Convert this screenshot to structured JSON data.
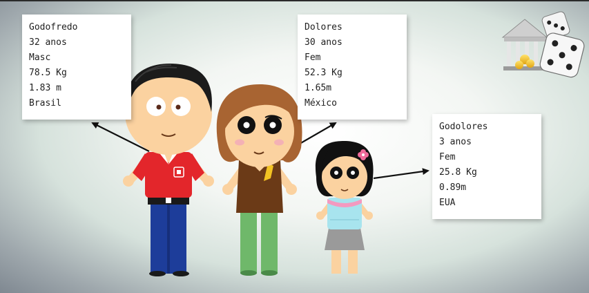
{
  "people": [
    {
      "id": "godofredo",
      "name": "Godofredo",
      "age": "32 anos",
      "sex": "Masc",
      "weight": "78.5 Kg",
      "height": "1.83 m",
      "country": "Brasil"
    },
    {
      "id": "dolores",
      "name": "Dolores",
      "age": "30 anos",
      "sex": "Fem",
      "weight": "52.3 Kg",
      "height": "1.65m",
      "country": "México"
    },
    {
      "id": "godolores",
      "name": "Godolores",
      "age": "3 anos",
      "sex": "Fem",
      "weight": "25.8 Kg",
      "height": "0.89m",
      "country": "EUA"
    }
  ],
  "colors": {
    "skin": "#fbd2a0",
    "shirt_red": "#e3262b",
    "pants_blue": "#1d3d9a",
    "hair_black": "#1b1b1b",
    "hair_brown": "#a86432",
    "top_brown": "#6b3a17",
    "pants_green": "#6fb86a",
    "shirt_cyan": "#a8e4ee",
    "skirt_gray": "#9a9a9a"
  },
  "icons": [
    "bank-icon",
    "dice-icon"
  ]
}
